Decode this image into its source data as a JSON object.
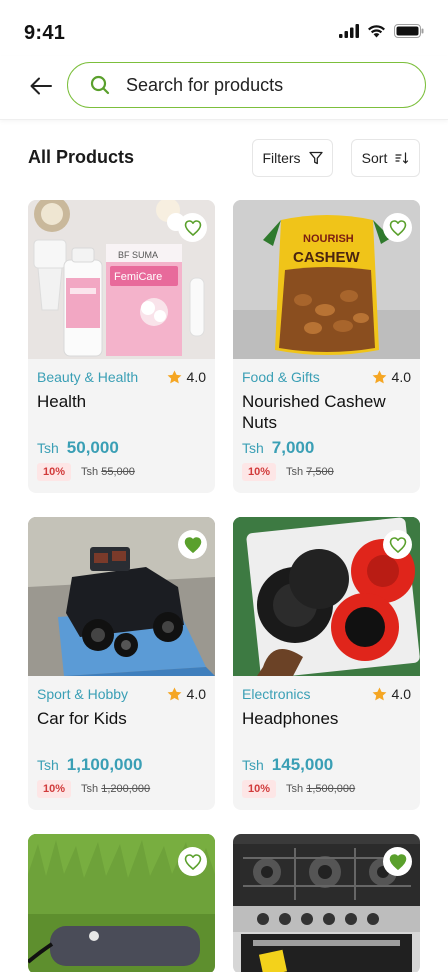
{
  "status_bar": {
    "time": "9:41"
  },
  "header": {
    "search_placeholder": "Search for products"
  },
  "section": {
    "title": "All Products",
    "filters_label": "Filters",
    "sort_label": "Sort"
  },
  "colors": {
    "accent_green": "#7cbf3c",
    "category_teal": "#3a9fb5",
    "star": "#f5a623",
    "discount_red": "#d13b3b"
  },
  "products": [
    {
      "category": "Beauty & Health",
      "rating": "4.0",
      "name": "Health",
      "currency": "Tsh",
      "price": "50,000",
      "discount": "10%",
      "old_currency": "Tsh",
      "old_price": "55,000",
      "favorited": false,
      "image": "femicare-product"
    },
    {
      "category": "Food & Gifts",
      "rating": "4.0",
      "name": "Nourished Cashew Nuts",
      "currency": "Tsh",
      "price": "7,000",
      "discount": "10%",
      "old_currency": "Tsh",
      "old_price": "7,500",
      "favorited": false,
      "image": "cashew-bag"
    },
    {
      "category": "Sport & Hobby",
      "rating": "4.0",
      "name": "Car for Kids",
      "currency": "Tsh",
      "price": "1,100,000",
      "discount": "10%",
      "old_currency": "Tsh",
      "old_price": "1,200,000",
      "favorited": true,
      "image": "kids-car"
    },
    {
      "category": "Electronics",
      "rating": "4.0",
      "name": "Headphones",
      "currency": "Tsh",
      "price": "145,000",
      "discount": "10%",
      "old_currency": "Tsh",
      "old_price": "1,500,000",
      "favorited": false,
      "image": "headphones"
    },
    {
      "favorited": false,
      "image": "grass-device"
    },
    {
      "favorited": true,
      "image": "gas-cooker"
    }
  ]
}
